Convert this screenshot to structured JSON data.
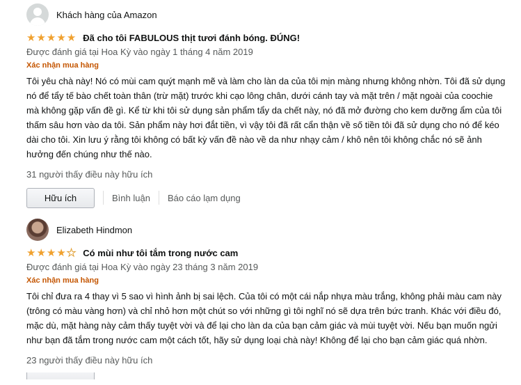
{
  "reviews": [
    {
      "author": "Khách hàng của Amazon",
      "rating": 5,
      "title": "Đã cho tôi FABULOUS thịt tươi đánh bóng. ĐÚNG!",
      "date": "Được đánh giá tại Hoa Kỳ vào ngày 1 tháng 4 năm 2019",
      "verified": "Xác nhận mua hàng",
      "body": "Tôi yêu chà này! Nó có mùi cam quýt mạnh mẽ và làm cho làn da của tôi mịn màng nhưng không nhờn. Tôi đã sử dụng nó để tẩy tế bào chết toàn thân (trừ mặt) trước khi cạo lông chân, dưới cánh tay và mặt trên / mặt ngoài của coochie mà không gặp vấn đề gì. Kể từ khi tôi sử dụng sản phẩm tẩy da chết này, nó đã mở đường cho kem dưỡng ẩm của tôi thấm sâu hơn vào da tôi. Sản phẩm này hơi đắt tiền, vì vậy tôi đã rất cẩn thận về số tiền tôi đã sử dụng cho nó để kéo dài cho tôi. Xin lưu ý rằng tôi không có bất kỳ vấn đề nào về da như nhạy cảm / khô nên tôi không chắc nó sẽ ảnh hưởng đến chúng như thế nào.",
      "helpful_count": "31 người thấy điều này hữu ích",
      "helpful_button": "Hữu ích",
      "comment_link": "Bình luận",
      "report_link": "Báo cáo lạm dụng"
    },
    {
      "author": "Elizabeth Hindmon",
      "rating": 4,
      "title": "Có mùi như tôi tắm trong nước cam",
      "date": "Được đánh giá tại Hoa Kỳ vào ngày 23 tháng 3 năm 2019",
      "verified": "Xác nhận mua hàng",
      "body": "Tôi chỉ đưa ra 4 thay vì 5 sao vì hình ảnh bị sai lệch. Của tôi có một cái nắp nhựa màu trắng, không phải màu cam này (trông có màu vàng hơn) và chỉ nhỏ hơn một chút so với những gì tôi nghĩ nó sẽ dựa trên bức tranh. Khác với điều đó, mặc dù, mặt hàng này cảm thấy tuyệt vời và để lại cho làn da của bạn cảm giác và mùi tuyệt vời. Nếu bạn muốn ngửi như bạn đã tắm trong nước cam một cách tốt, hãy sử dụng loại chà này! Không để lại cho bạn cảm giác quá nhờn.",
      "helpful_count": "23 người thấy điều này hữu ích"
    }
  ],
  "colors": {
    "star": "#f0a12f",
    "verified": "#c45500",
    "muted": "#565959"
  }
}
